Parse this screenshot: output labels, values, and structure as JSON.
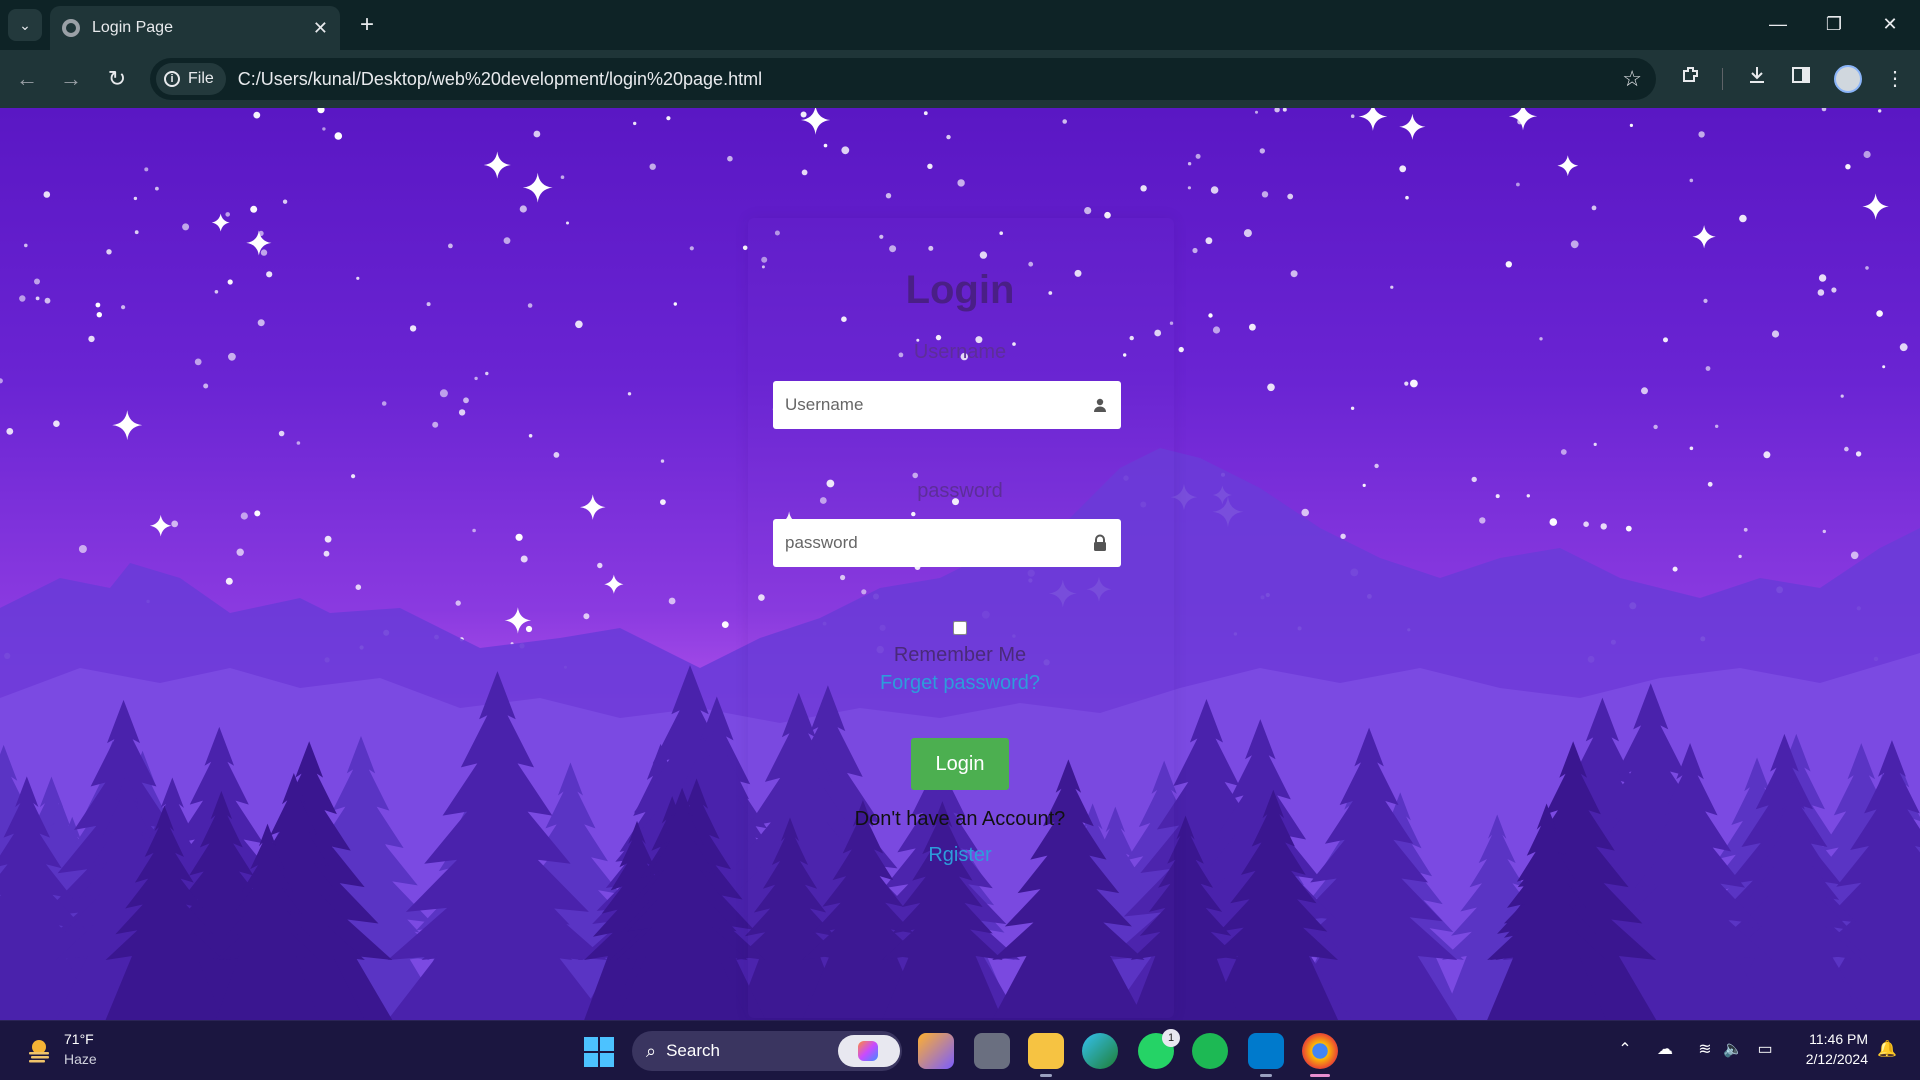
{
  "browser": {
    "tab_title": "Login Page",
    "url_chip": "File",
    "url": "C:/Users/kunal/Desktop/web%20development/login%20page.html",
    "icons": {
      "tab_search": "chevron-down-icon",
      "tab_close": "close-icon",
      "new_tab": "plus-icon",
      "back": "arrow-left-icon",
      "forward": "arrow-right-icon",
      "reload": "reload-icon",
      "info": "info-icon",
      "bookmark": "star-icon",
      "extensions": "puzzle-icon",
      "downloads": "download-icon",
      "side_panel": "side-panel-icon",
      "menu": "kebab-menu-icon"
    }
  },
  "page": {
    "title": "Login",
    "username_label": "Username",
    "username_placeholder": "Username",
    "password_label": "password",
    "password_placeholder": "password",
    "remember_label": "Remember Me",
    "forgot_link": "Forget password?",
    "login_button": "Login",
    "no_account_text": "Don't have an Account?",
    "register_link": "Rgister",
    "colors": {
      "title": "#4a1f86",
      "link": "#2d9cdb",
      "button": "#4caf50",
      "sky_top": "#5a17c4",
      "sky_glow": "#c05ef0"
    }
  },
  "taskbar": {
    "weather_temp": "71°F",
    "weather_condition": "Haze",
    "search_placeholder": "Search",
    "whatsapp_badge": "1",
    "time": "11:46 PM",
    "date": "2/12/2024"
  }
}
